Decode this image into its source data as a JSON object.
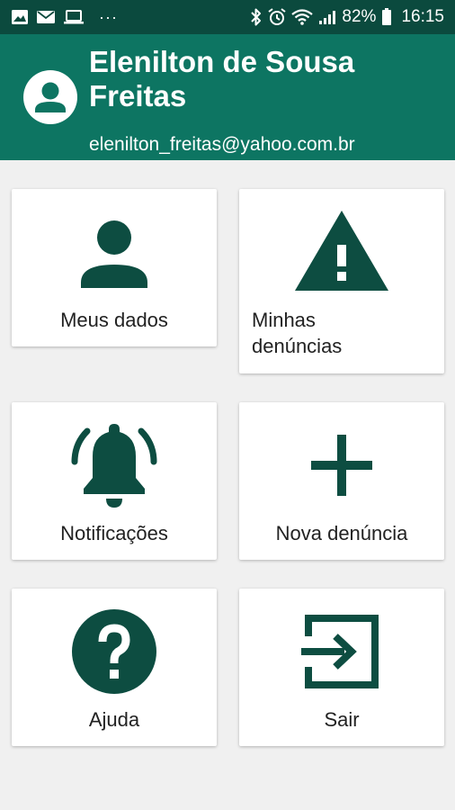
{
  "status_bar": {
    "battery_percent": "82%",
    "time": "16:15",
    "more": "···",
    "left_icons": [
      "image-icon",
      "mail-icon",
      "laptop-icon"
    ],
    "right_icons": [
      "bluetooth-icon",
      "alarm-icon",
      "wifi-icon",
      "signal-icon",
      "battery-icon"
    ]
  },
  "header": {
    "user_name": "Elenilton de Sousa Freitas",
    "email": "elenilton_freitas@yahoo.com.br"
  },
  "menu": {
    "items": [
      {
        "label": "Meus dados",
        "icon": "person-icon"
      },
      {
        "label": "Minhas denúncias",
        "icon": "warning-icon"
      },
      {
        "label": "Notificações",
        "icon": "bell-ringing-icon"
      },
      {
        "label": "Nova denúncia",
        "icon": "plus-icon"
      },
      {
        "label": "Ajuda",
        "icon": "help-circle-icon"
      },
      {
        "label": "Sair",
        "icon": "exit-icon"
      }
    ]
  },
  "colors": {
    "status_bar": "#0b4a3e",
    "header": "#0d7562",
    "icon": "#0d4d41",
    "background": "#f0f0f0",
    "card": "#ffffff"
  }
}
